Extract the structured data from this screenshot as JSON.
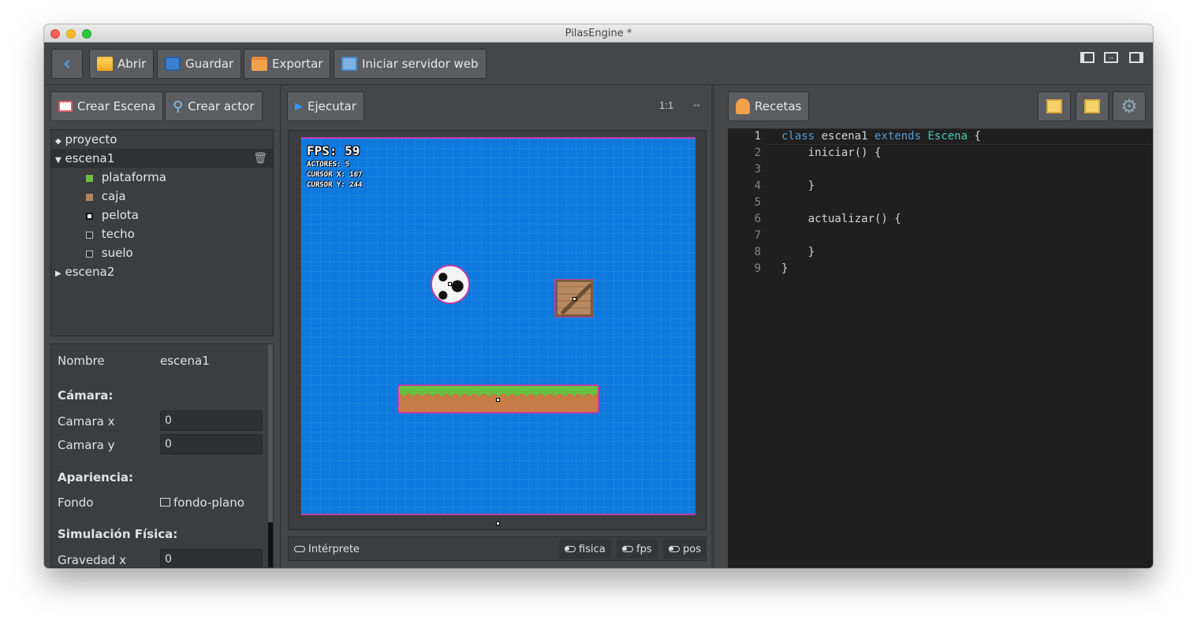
{
  "window": {
    "title": "PilasEngine *"
  },
  "toolbar": {
    "back_label": "‹",
    "open_label": "Abrir",
    "save_label": "Guardar",
    "export_label": "Exportar",
    "server_label": "Iniciar servidor web"
  },
  "left_panel": {
    "create_scene_label": "Crear Escena",
    "create_actor_label": "Crear actor",
    "tree": {
      "project": "proyecto",
      "scene1": "escena1",
      "actors": [
        {
          "label": "plataforma",
          "color": "#6abf45"
        },
        {
          "label": "caja",
          "color": "#b5835a"
        },
        {
          "label": "pelota",
          "color": "#ffffff"
        },
        {
          "label": "techo",
          "color": "#2f3133"
        },
        {
          "label": "suelo",
          "color": "#2f3133"
        }
      ],
      "scene2": "escena2"
    },
    "props": {
      "name_label": "Nombre",
      "name_value": "escena1",
      "camera_heading": "Cámara:",
      "camera_x_label": "Camara x",
      "camera_x_value": "0",
      "camera_y_label": "Camara y",
      "camera_y_value": "0",
      "appearance_heading": "Apariencia:",
      "background_label": "Fondo",
      "background_value": "fondo-plano",
      "physics_heading": "Simulación Física:",
      "gravity_x_label": "Gravedad x",
      "gravity_x_value": "0"
    }
  },
  "center_panel": {
    "run_label": "Ejecutar",
    "zoom_label": "1:1",
    "hud": {
      "fps": "FPS: 59",
      "actors": "ACTORES: 5",
      "cursor_x": "CURSOR X: 167",
      "cursor_y": "CURSOR Y: 244"
    },
    "console": {
      "interpreter_label": "Intérprete",
      "physics_label": "fisica",
      "fps_label": "fps",
      "pos_label": "pos"
    }
  },
  "right_panel": {
    "recipes_label": "Recetas",
    "code_lines": [
      {
        "n": "1",
        "text": "class escena1 extends Escena {"
      },
      {
        "n": "2",
        "text": "    iniciar() {"
      },
      {
        "n": "3",
        "text": ""
      },
      {
        "n": "4",
        "text": "    }"
      },
      {
        "n": "5",
        "text": ""
      },
      {
        "n": "6",
        "text": "    actualizar() {"
      },
      {
        "n": "7",
        "text": ""
      },
      {
        "n": "8",
        "text": "    }"
      },
      {
        "n": "9",
        "text": "}"
      }
    ]
  },
  "colors": {
    "accent": "#0d78dd",
    "selection_outline": "#c23ca6",
    "keyword": "#569cd6",
    "class_name": "#4ec9b0"
  }
}
